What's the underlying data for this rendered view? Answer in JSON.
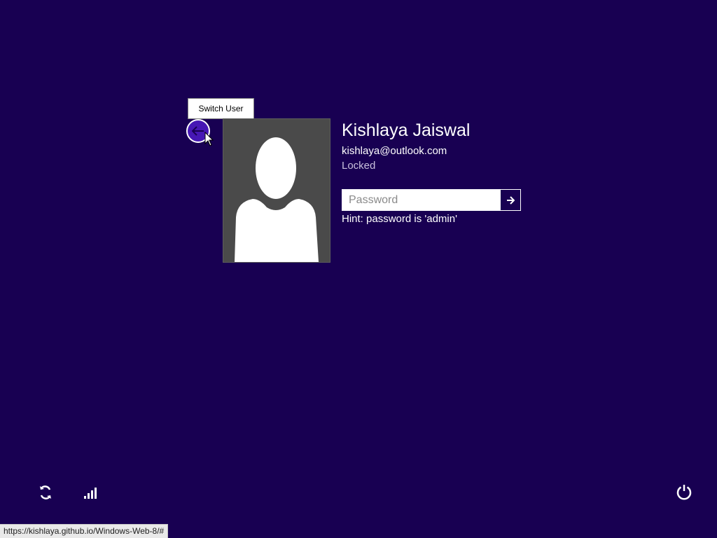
{
  "tooltip": {
    "text": "Switch User"
  },
  "back_button": {
    "icon": "arrow-left-icon"
  },
  "user": {
    "name": "Kishlaya Jaiswal",
    "email": "kishlaya@outlook.com",
    "status": "Locked",
    "avatar_icon": "default-user-silhouette"
  },
  "password": {
    "placeholder": "Password",
    "value": "",
    "submit_icon": "arrow-right-icon"
  },
  "hint": "Hint: password is 'admin'",
  "bottom_bar": {
    "ease_of_access_icon": "ease-of-access-icon",
    "network_icon": "network-signal-icon",
    "power_icon": "power-icon"
  },
  "status_url": "https://kishlaya.github.io/Windows-Web-8/#",
  "colors": {
    "background": "#180052",
    "back_button": "#4617b4",
    "avatar_bg": "#4a4a4a"
  }
}
